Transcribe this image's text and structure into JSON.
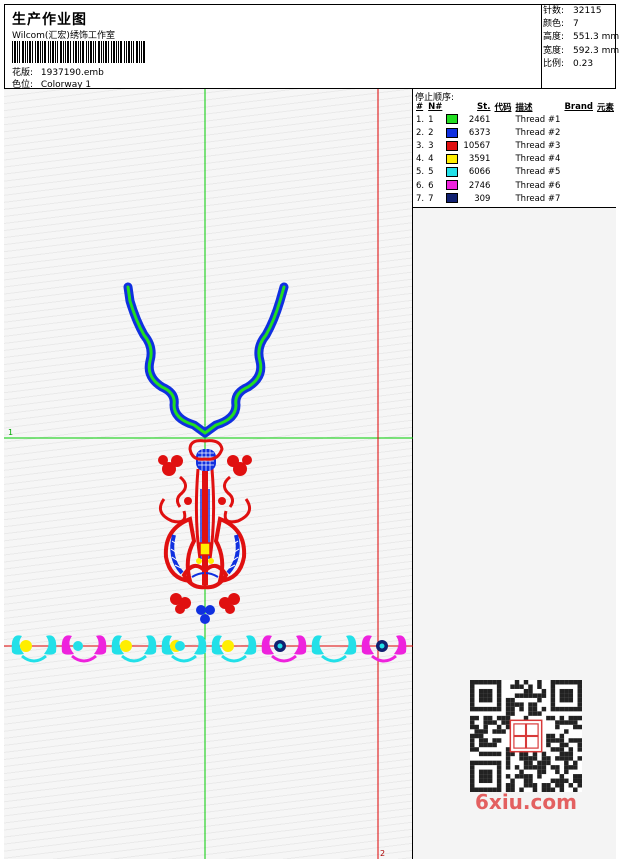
{
  "header": {
    "title": "生产作业图",
    "company": "Wilcom(汇宏)绣饰工作室",
    "design_label": "花版:",
    "design_value": "1937190.emb",
    "colorway_label": "色位:",
    "colorway_value": "Colorway 1"
  },
  "stats": [
    {
      "label": "针数:",
      "value": "32115"
    },
    {
      "label": "颜色:",
      "value": "7"
    },
    {
      "label": "高度:",
      "value": "551.3 mm"
    },
    {
      "label": "宽度:",
      "value": "592.3 mm"
    },
    {
      "label": "比例:",
      "value": "0.23"
    }
  ],
  "stop_sequence": {
    "caption": "停止顺序:",
    "headers": [
      "#",
      "N#",
      "St.",
      "代码",
      "描述",
      "Brand",
      "元素"
    ],
    "rows": [
      {
        "idx": "1.",
        "n": "1",
        "color": "#22dd22",
        "stitches": "2461",
        "desc": "Thread #1"
      },
      {
        "idx": "2.",
        "n": "2",
        "color": "#1030e0",
        "stitches": "6373",
        "desc": "Thread #2"
      },
      {
        "idx": "3.",
        "n": "3",
        "color": "#e01010",
        "stitches": "10567",
        "desc": "Thread #3"
      },
      {
        "idx": "4.",
        "n": "4",
        "color": "#ffee00",
        "stitches": "3591",
        "desc": "Thread #4"
      },
      {
        "idx": "5.",
        "n": "5",
        "color": "#22e0e8",
        "stitches": "6066",
        "desc": "Thread #5"
      },
      {
        "idx": "6.",
        "n": "6",
        "color": "#ee22dd",
        "stitches": "2746",
        "desc": "Thread #6"
      },
      {
        "idx": "7.",
        "n": "7",
        "color": "#102070",
        "stitches": "309",
        "desc": "Thread #7"
      }
    ]
  },
  "canvas": {
    "guide_label_left": "1",
    "guide_label_bottom": "2",
    "watermark": "6xiu.com"
  },
  "colors": {
    "green_guide": "#00cc00",
    "red_guide": "#dd0000"
  }
}
